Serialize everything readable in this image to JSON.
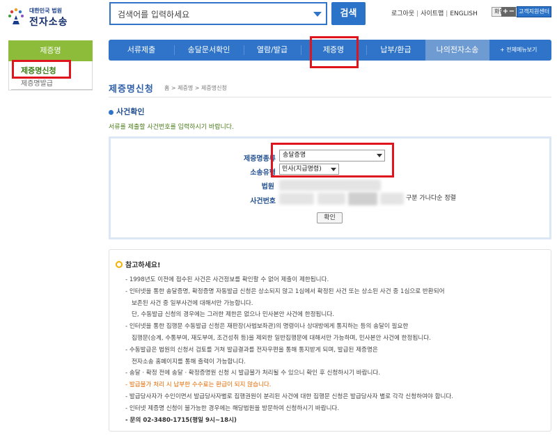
{
  "header": {
    "logo_top": "대한민국 법원",
    "logo_main": "전자소송",
    "search_placeholder": "검색어를 입력하세요",
    "search_button": "검색",
    "util_links": [
      "로그아웃",
      "사이트맵",
      "ENGLISH"
    ],
    "font_size_label": "화면크기",
    "font_plus": "+",
    "font_minus": "−",
    "cs_button": "고객지원센터"
  },
  "sidebar": {
    "title": "제증명",
    "items": [
      {
        "label": "제증명신청",
        "active": true
      },
      {
        "label": "제증명발급",
        "active": false
      }
    ]
  },
  "nav": {
    "items": [
      "서류제출",
      "송달문서확인",
      "열람/발급",
      "제증명",
      "납부/환급",
      "나의전자소송"
    ],
    "all_menu": "+ 전체메뉴보기",
    "active": "제증명"
  },
  "page": {
    "title": "제증명신청",
    "breadcrumb": "홈 > 제증명 > 제증명신청",
    "section_title": "사건확인",
    "section_desc": "서류를 제출할 사건번호를 입력하시기 바랍니다."
  },
  "form": {
    "labels": {
      "cert_type": "제증명종류",
      "case_type": "소송유형",
      "court": "법원",
      "case_number": "사건번호"
    },
    "cert_type_value": "송달증명",
    "case_type_value": "민사(지급명령)",
    "sort_hint": "구분 가나다순 정렬",
    "confirm_button": "확인"
  },
  "notice": {
    "title": "참고하세요!",
    "lines": [
      {
        "text": "- 1998년도 이전에 접수된 사건은 사건정보를 확인할 수 없어 제출이 제한됩니다.",
        "style": "normal"
      },
      {
        "text": "- 인터넷을 통한 송달증명, 확정증명 자동발급 신청은 상소되지 않고 1심에서 확정된 사건 또는 상소된 사건 중 1심으로 반환되어",
        "style": "normal"
      },
      {
        "text": "보존된 사건 중 일부사건에 대해서만 가능합니다.",
        "style": "ind"
      },
      {
        "text": "단, 수동발급 신청의 경우에는 그러한 제한은 없으나 민사본안 사건에 한정됩니다.",
        "style": "ind"
      },
      {
        "text": "- 인터넷을 통한 집행문 수동발급 신청은 재판장(사법보좌관)의 명령이나 상대방에게 통지하는 등의 송달이 필요한",
        "style": "normal"
      },
      {
        "text": "집행문(승계, 수통부여, 재도부여, 조건성취 등)을 제외한 일반집행문에 대해서만 가능하며, 민사본안 사건에 한정됩니다.",
        "style": "ind"
      },
      {
        "text": "- 수동발급은 법원의 신청서 검토를 거쳐 발급결과를 전자우편을 통해 통지받게 되며, 발급된 제증명은",
        "style": "normal"
      },
      {
        "text": "전자소송 홈페이지를 통해 출력이 가능합니다.",
        "style": "ind"
      },
      {
        "text": "- 송달 · 확정 전에 송달 · 확정증명원 신청 시 발급불가 처리될 수 있으니 확인 후 신청하시기 바랍니다.",
        "style": "normal"
      },
      {
        "text": "- 발급불가 처리 시 납부한 수수료는 환급이 되지 않습니다.",
        "style": "warn"
      },
      {
        "text": "- 발급당사자가 수인이면서 발급당사자별로 집행권원이 분리된 사건에 대한 집행문 신청은 발급당사자 별로 각각 신청하여야 합니다.",
        "style": "normal"
      },
      {
        "text": "- 인터넷 제증명 신청이 불가능한 경우에는 해당법원을 방문하여 신청하시기 바랍니다.",
        "style": "normal"
      },
      {
        "text": "- 문의 02-3480-1715(평일 9시~18시)",
        "style": "bold"
      }
    ]
  }
}
